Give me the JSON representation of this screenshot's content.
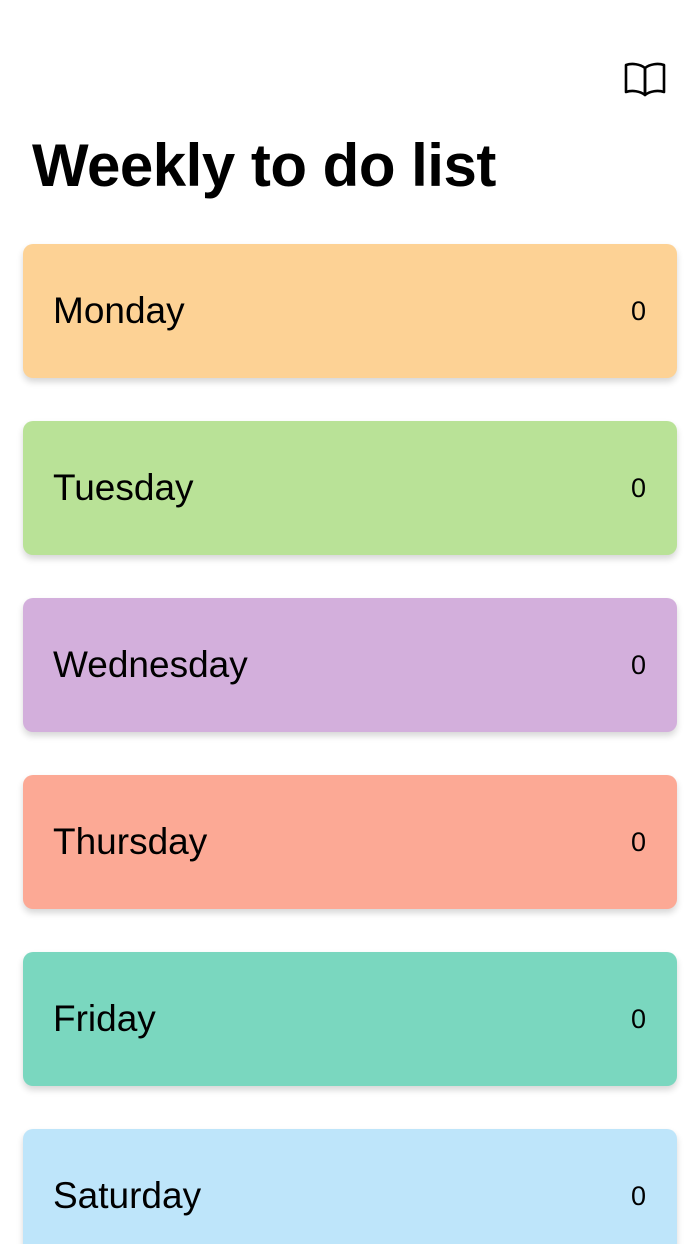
{
  "header": {
    "title": "Weekly to do list",
    "book_icon": "book-open-icon"
  },
  "days": [
    {
      "name": "Monday",
      "count": "0",
      "color": "#FDD295"
    },
    {
      "name": "Tuesday",
      "count": "0",
      "color": "#B9E297"
    },
    {
      "name": "Wednesday",
      "count": "0",
      "color": "#D3AFDC"
    },
    {
      "name": "Thursday",
      "count": "0",
      "color": "#FCA995"
    },
    {
      "name": "Friday",
      "count": "0",
      "color": "#7AD7BF"
    },
    {
      "name": "Saturday",
      "count": "0",
      "color": "#BEE5FA"
    }
  ]
}
